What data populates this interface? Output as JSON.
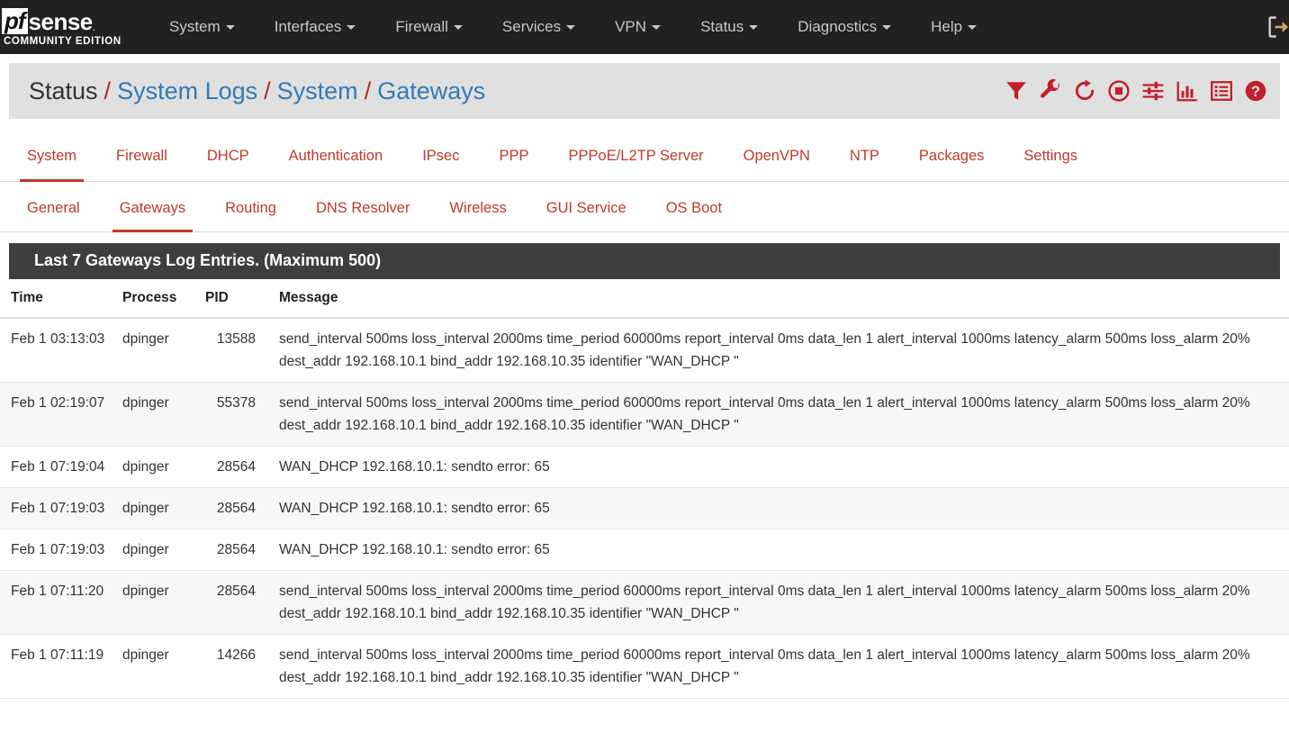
{
  "navbar": {
    "brand": {
      "pf": "pf",
      "sense": "sense",
      "subtitle": "COMMUNITY EDITION"
    },
    "items": [
      {
        "label": "System"
      },
      {
        "label": "Interfaces"
      },
      {
        "label": "Firewall"
      },
      {
        "label": "Services"
      },
      {
        "label": "VPN"
      },
      {
        "label": "Status"
      },
      {
        "label": "Diagnostics"
      },
      {
        "label": "Help"
      }
    ],
    "logout_icon": "sign-out-icon"
  },
  "breadcrumb": {
    "root": "Status",
    "sep": "/",
    "links": [
      "System Logs",
      "System",
      "Gateways"
    ],
    "icons": [
      "filter-icon",
      "wrench-icon",
      "refresh-icon",
      "pause-icon",
      "sliders-icon",
      "bar-chart-icon",
      "list-icon",
      "help-icon"
    ]
  },
  "tabs_primary": {
    "active": "System",
    "items": [
      "System",
      "Firewall",
      "DHCP",
      "Authentication",
      "IPsec",
      "PPP",
      "PPPoE/L2TP Server",
      "OpenVPN",
      "NTP",
      "Packages",
      "Settings"
    ]
  },
  "tabs_secondary": {
    "active": "Gateways",
    "items": [
      "General",
      "Gateways",
      "Routing",
      "DNS Resolver",
      "Wireless",
      "GUI Service",
      "OS Boot"
    ]
  },
  "panel": {
    "title": "Last 7 Gateways Log Entries. (Maximum 500)",
    "columns": [
      "Time",
      "Process",
      "PID",
      "Message"
    ],
    "rows": [
      {
        "time": "Feb 1 03:13:03",
        "process": "dpinger",
        "pid": "13588",
        "message": "send_interval 500ms loss_interval 2000ms time_period 60000ms report_interval 0ms data_len 1 alert_interval 1000ms latency_alarm 500ms loss_alarm 20% dest_addr 192.168.10.1 bind_addr 192.168.10.35 identifier \"WAN_DHCP \""
      },
      {
        "time": "Feb 1 02:19:07",
        "process": "dpinger",
        "pid": "55378",
        "message": "send_interval 500ms loss_interval 2000ms time_period 60000ms report_interval 0ms data_len 1 alert_interval 1000ms latency_alarm 500ms loss_alarm 20% dest_addr 192.168.10.1 bind_addr 192.168.10.35 identifier \"WAN_DHCP \""
      },
      {
        "time": "Feb 1 07:19:04",
        "process": "dpinger",
        "pid": "28564",
        "message": "WAN_DHCP 192.168.10.1: sendto error: 65"
      },
      {
        "time": "Feb 1 07:19:03",
        "process": "dpinger",
        "pid": "28564",
        "message": "WAN_DHCP 192.168.10.1: sendto error: 65"
      },
      {
        "time": "Feb 1 07:19:03",
        "process": "dpinger",
        "pid": "28564",
        "message": "WAN_DHCP 192.168.10.1: sendto error: 65"
      },
      {
        "time": "Feb 1 07:11:20",
        "process": "dpinger",
        "pid": "28564",
        "message": "send_interval 500ms loss_interval 2000ms time_period 60000ms report_interval 0ms data_len 1 alert_interval 1000ms latency_alarm 500ms loss_alarm 20% dest_addr 192.168.10.1 bind_addr 192.168.10.35 identifier \"WAN_DHCP \""
      },
      {
        "time": "Feb 1 07:11:19",
        "process": "dpinger",
        "pid": "14266",
        "message": "send_interval 500ms loss_interval 2000ms time_period 60000ms report_interval 0ms data_len 1 alert_interval 1000ms latency_alarm 500ms loss_alarm 20% dest_addr 192.168.10.1 bind_addr 192.168.10.35 identifier \"WAN_DHCP \""
      }
    ]
  },
  "colors": {
    "navbar_bg": "#212121",
    "accent_red": "#c0392b",
    "link_blue": "#337ab7",
    "panel_head_bg": "#3e3e3e",
    "crumbbar_bg": "#e0e0e0"
  }
}
